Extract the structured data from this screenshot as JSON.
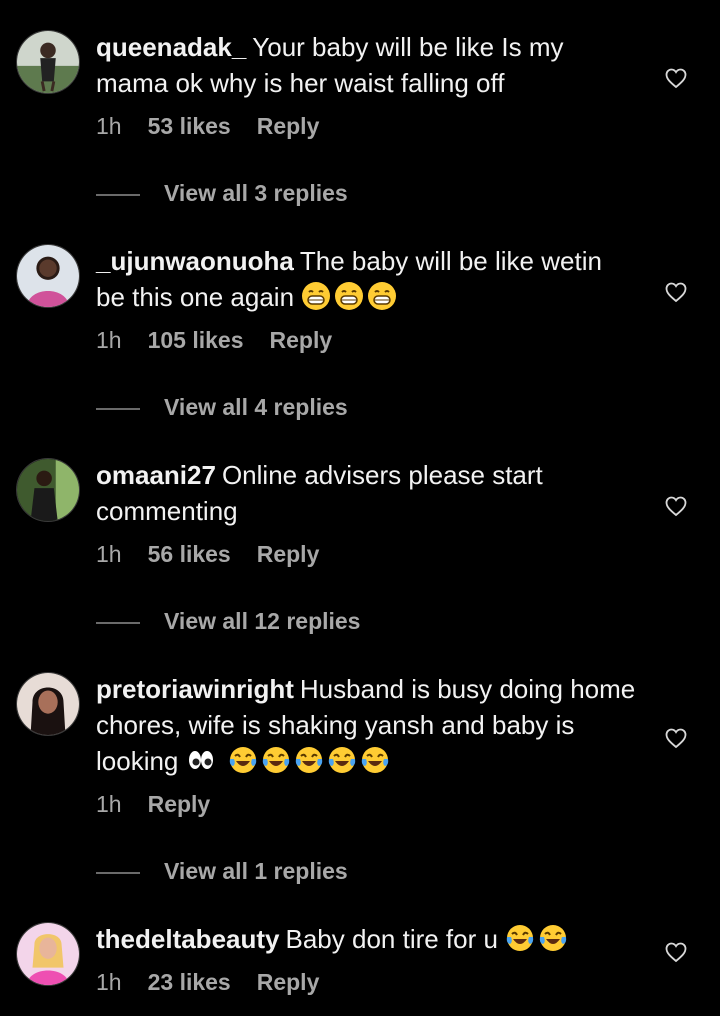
{
  "comments": [
    {
      "username": "queenadak_",
      "text": "Your baby will be like Is my mama ok why is her waist falling off",
      "time": "1h",
      "likes": "53 likes",
      "reply": "Reply",
      "view_replies": "View all 3 replies",
      "avatar_color": "#6b7a5e"
    },
    {
      "username": "_ujunwaonuoha",
      "text": "The baby will be like wetin be this one again",
      "emojis": [
        "grin-emoji",
        "grin-emoji",
        "grin-emoji"
      ],
      "time": "1h",
      "likes": "105 likes",
      "reply": "Reply",
      "view_replies": "View all 4 replies",
      "avatar_color": "#5a6d86"
    },
    {
      "username": "omaani27",
      "text": "Online advisers please start commenting",
      "time": "1h",
      "likes": "56 likes",
      "reply": "Reply",
      "view_replies": "View all 12 replies",
      "avatar_color": "#4f6b3a"
    },
    {
      "username": "pretoriawinright",
      "text": "Husband is busy doing home chores, wife is shaking yansh and baby is looking",
      "emojis": [
        "eyes-emoji",
        "tears-of-joy-emoji",
        "tears-of-joy-emoji",
        "tears-of-joy-emoji",
        "tears-of-joy-emoji",
        "tears-of-joy-emoji"
      ],
      "time": "1h",
      "reply": "Reply",
      "view_replies": "View all 1 replies",
      "avatar_color": "#7a5a4c"
    },
    {
      "username": "thedeltabeauty",
      "text": "Baby don tire for u",
      "emojis": [
        "tears-of-joy-emoji",
        "tears-of-joy-emoji"
      ],
      "time": "1h",
      "likes": "23 likes",
      "reply": "Reply",
      "avatar_color": "#e59ad0"
    }
  ],
  "colors": {
    "background": "#000000",
    "text": "#f2f2f2",
    "secondary": "#a8a8a8"
  }
}
